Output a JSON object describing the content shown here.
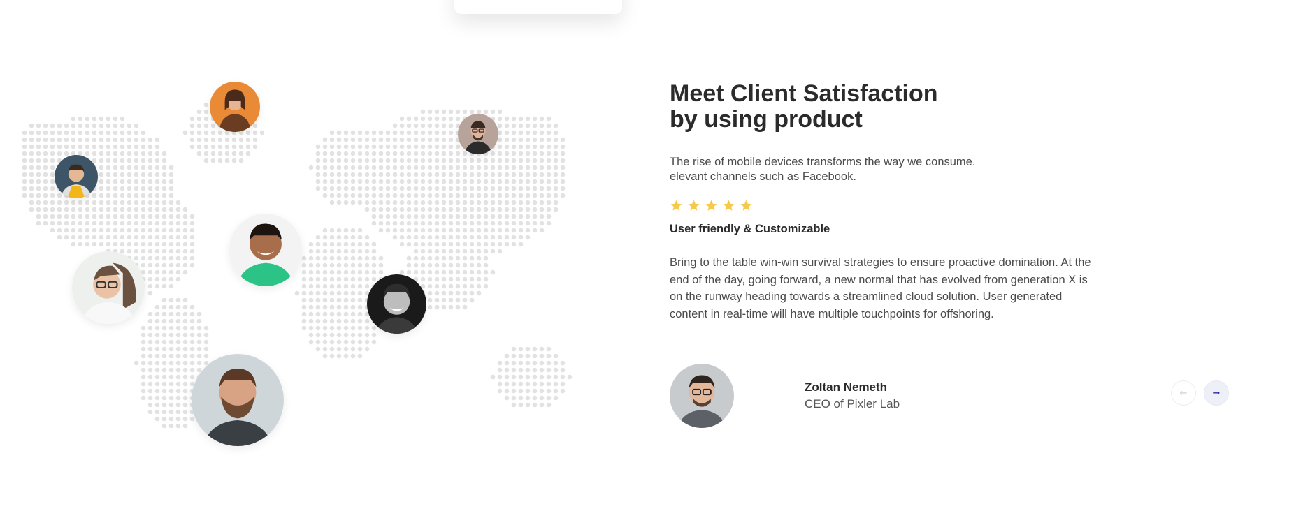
{
  "section": {
    "heading_line1": "Meet Client Satisfaction",
    "heading_line2": "by using product",
    "intro_line1": "The rise of mobile devices transforms the way we consume.",
    "intro_line2": "elevant channels such as Facebook.",
    "rating": 5,
    "rating_max": 5,
    "subheading": "User friendly & Customizable",
    "body": "Bring to the table win-win survival strategies to ensure proactive domination. At the end of the day, going forward, a new normal that has evolved from generation X is on the runway heading towards a streamlined cloud solution. User generated content in real-time will have multiple touchpoints for offshoring."
  },
  "testimonial": {
    "name": "Zoltan Nemeth",
    "role": "CEO of Pixler Lab"
  },
  "navigation": {
    "prev_icon": "arrow-left-icon",
    "next_icon": "arrow-right-icon"
  },
  "colors": {
    "star": "#f7c948",
    "heading": "#2b2b2b",
    "map_dot": "#e2e2e2",
    "next_arrow": "#2a2aa8"
  }
}
